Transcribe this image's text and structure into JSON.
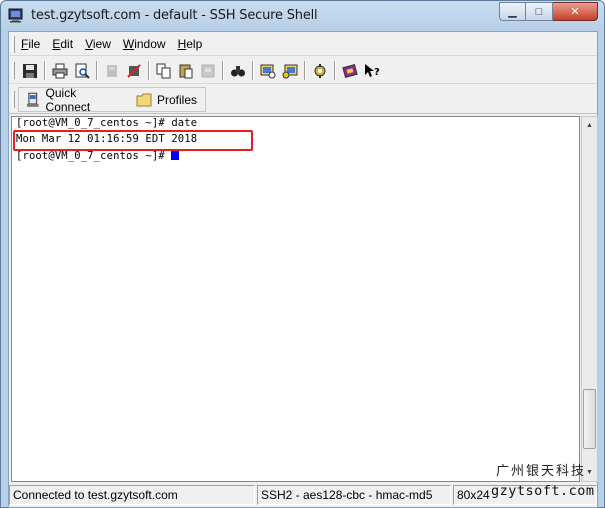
{
  "window": {
    "title": "test.gzytsoft.com - default - SSH Secure Shell",
    "minimize": "▁",
    "maximize": "□",
    "close": "✕"
  },
  "menu": [
    {
      "label": "File",
      "ul": "F",
      "rest": "ile"
    },
    {
      "label": "Edit",
      "ul": "E",
      "rest": "dit"
    },
    {
      "label": "View",
      "ul": "V",
      "rest": "iew"
    },
    {
      "label": "Window",
      "ul": "W",
      "rest": "indow"
    },
    {
      "label": "Help",
      "ul": "H",
      "rest": "elp"
    }
  ],
  "toolbar": {
    "icons": [
      "save-icon",
      "print-icon",
      "print-preview-icon",
      "disconnect-icon",
      "new-connection-icon",
      "copy-icon",
      "paste-icon",
      "paste-disabled-icon",
      "find-icon",
      "settings-icon",
      "profile-settings-icon",
      "sftp-icon",
      "help-book-icon",
      "context-help-icon"
    ]
  },
  "quickbar": {
    "quick_connect": "Quick Connect",
    "profiles": "Profiles"
  },
  "terminal": {
    "lines": [
      "[root@VM_0_7_centos ~]# date",
      "Mon Mar 12 01:16:59 EDT 2018",
      "[root@VM_0_7_centos ~]# "
    ],
    "accent": "#e8201b",
    "cursor_color": "#0000ff"
  },
  "status": {
    "connection": "Connected to test.gzytsoft.com",
    "cipher": "SSH2 - aes128-cbc - hmac-md5",
    "size": "80x24"
  },
  "watermark": {
    "cn": "广州银天科技",
    "en": "gzytsoft.com"
  }
}
